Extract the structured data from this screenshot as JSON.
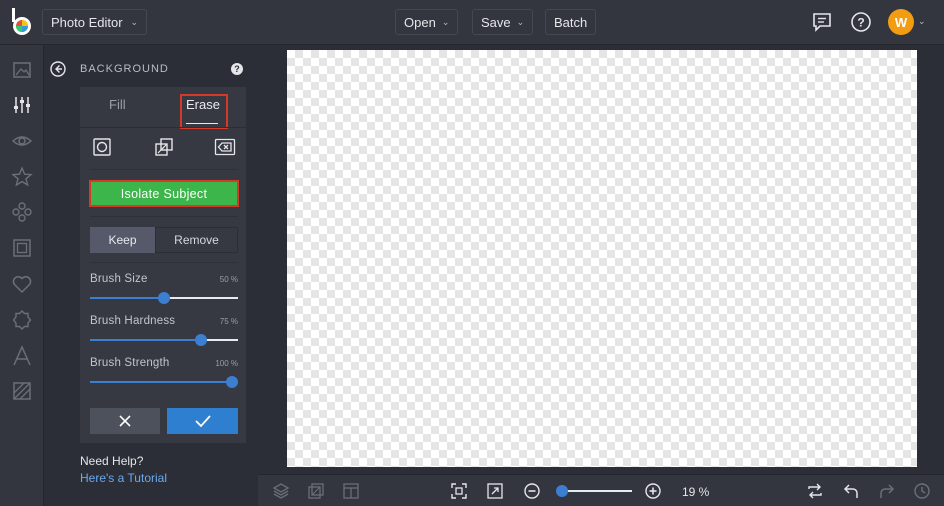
{
  "header": {
    "app_title": "Photo Editor",
    "open_label": "Open",
    "save_label": "Save",
    "batch_label": "Batch",
    "avatar_initial": "W"
  },
  "rail_icons": [
    "image-icon",
    "adjustments-icon",
    "eye-icon",
    "star-icon",
    "shapes-icon",
    "frame-icon",
    "heart-icon",
    "badge-icon",
    "text-icon",
    "texture-icon"
  ],
  "panel": {
    "title": "BACKGROUND",
    "help": "?",
    "tabs": [
      {
        "label": "Fill",
        "active": false
      },
      {
        "label": "Erase",
        "active": true
      }
    ],
    "isolate_label": "Isolate Subject",
    "keep_label": "Keep",
    "remove_label": "Remove",
    "sliders": [
      {
        "label": "Brush Size",
        "value_text": "50 %",
        "value": 50
      },
      {
        "label": "Brush Hardness",
        "value_text": "75 %",
        "value": 75
      },
      {
        "label": "Brush Strength",
        "value_text": "100 %",
        "value": 100
      }
    ],
    "help_text": "Need Help?",
    "tutorial_link": "Here's a Tutorial"
  },
  "bottom": {
    "zoom_text": "19 %",
    "zoom_value": 19
  },
  "colors": {
    "accent_blue": "#3c7fd0",
    "isolate_green": "#3cb54a",
    "highlight_red": "#d43a2a",
    "avatar_orange": "#f39c12"
  }
}
